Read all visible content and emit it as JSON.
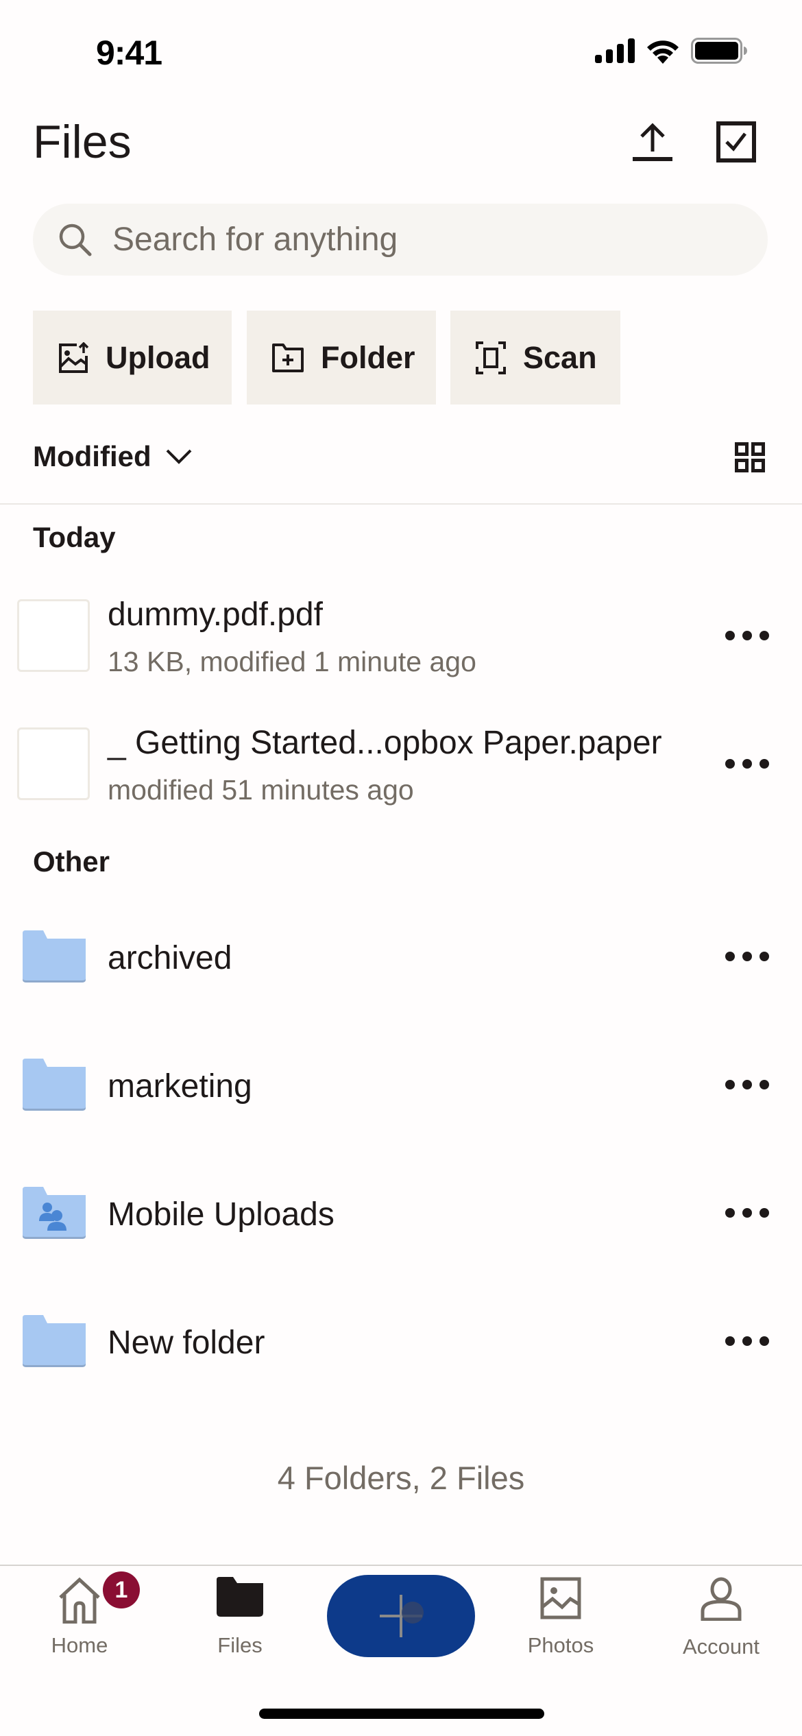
{
  "status_bar": {
    "time": "9:41",
    "icons": [
      "cellular-signal-icon",
      "wifi-icon",
      "battery-icon"
    ]
  },
  "header": {
    "title": "Files",
    "actions": [
      {
        "name": "upload-icon",
        "label": "Upload"
      },
      {
        "name": "select-checkbox-icon",
        "label": "Select"
      }
    ]
  },
  "search": {
    "placeholder": "Search for anything",
    "value": ""
  },
  "quick_actions": [
    {
      "label": "Upload",
      "icon": "photo-upload-icon"
    },
    {
      "label": "Folder",
      "icon": "new-folder-icon"
    },
    {
      "label": "Scan",
      "icon": "scan-icon"
    }
  ],
  "sort": {
    "label": "Modified",
    "view_toggle_icon": "grid-view-icon"
  },
  "sections": {
    "today": "Today",
    "other": "Other"
  },
  "files": [
    {
      "name": "dummy.pdf.pdf",
      "subtitle": "13 KB, modified 1 minute ago"
    },
    {
      "name": "_ Getting Started...opbox Paper.paper",
      "subtitle": "modified 51 minutes ago"
    }
  ],
  "folders": [
    {
      "name": "archived",
      "type": "folder"
    },
    {
      "name": "marketing",
      "type": "folder"
    },
    {
      "name": "Mobile Uploads",
      "type": "shared-folder"
    },
    {
      "name": "New folder",
      "type": "folder"
    }
  ],
  "summary": "4 Folders, 2 Files",
  "tabbar": {
    "tabs": [
      {
        "label": "Home",
        "badge": "1",
        "active": false
      },
      {
        "label": "Files",
        "active": true
      },
      {
        "label": "Photos",
        "active": false
      },
      {
        "label": "Account",
        "active": false
      }
    ],
    "fab_icon": "plus-icon"
  },
  "colors": {
    "accent": "#0d3a8a",
    "badge": "#8a0e33",
    "folder": "#a7c8f2",
    "button_bg": "#f3efe9",
    "search_bg": "#f7f5f2",
    "secondary_text": "#736c64"
  }
}
